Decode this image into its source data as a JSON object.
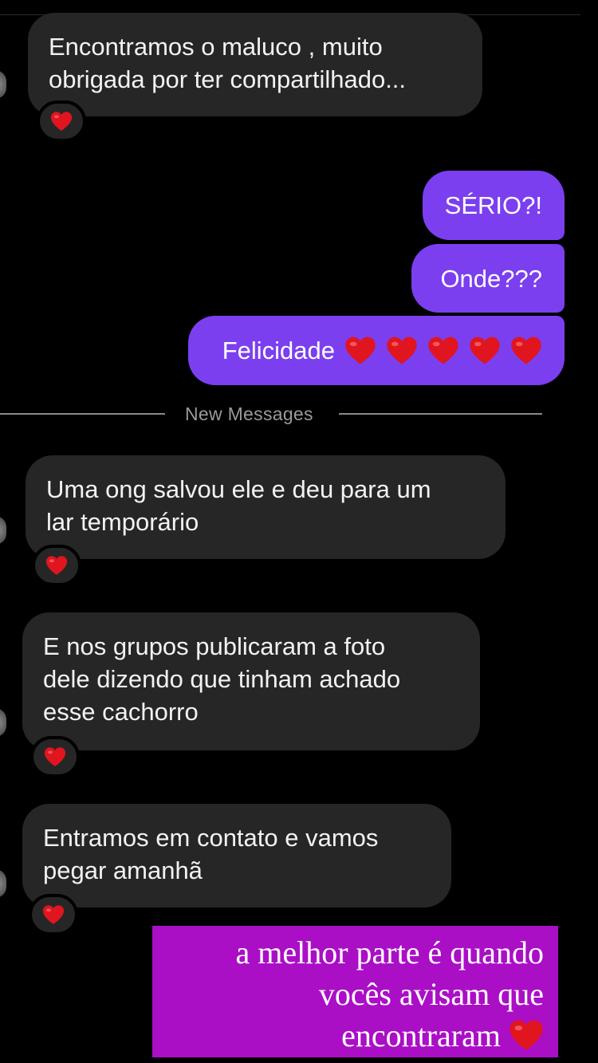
{
  "messages": {
    "incoming_1": {
      "text": "Encontramos o maluco , muito\nobrigada por ter compartilhado...",
      "reaction": "heart-emoji"
    },
    "outgoing_1": {
      "text": "SÉRIO?!"
    },
    "outgoing_2": {
      "text": "Onde???"
    },
    "outgoing_3": {
      "text": "Felicidade",
      "emoji_count": 5
    },
    "incoming_2": {
      "text": "Uma ong salvou ele e deu para um\nlar temporário",
      "reaction": "heart-emoji"
    },
    "incoming_3": {
      "text": "E nos grupos publicaram a foto\ndele dizendo que tinham achado\nesse cachorro",
      "reaction": "heart-emoji"
    },
    "incoming_4": {
      "text": "Entramos em contato e vamos\npegar amanhã",
      "reaction": "heart-emoji"
    }
  },
  "divider": {
    "label": "New Messages"
  },
  "caption": {
    "line1": "a melhor parte é quando",
    "line2": "vocês avisam que",
    "line3": "encontraram"
  },
  "colors": {
    "background": "#000000",
    "incoming_bubble": "#262626",
    "outgoing_bubble": "#7b3ff0",
    "caption_bg": "#aa0fc6",
    "heart": "#e0151f"
  }
}
